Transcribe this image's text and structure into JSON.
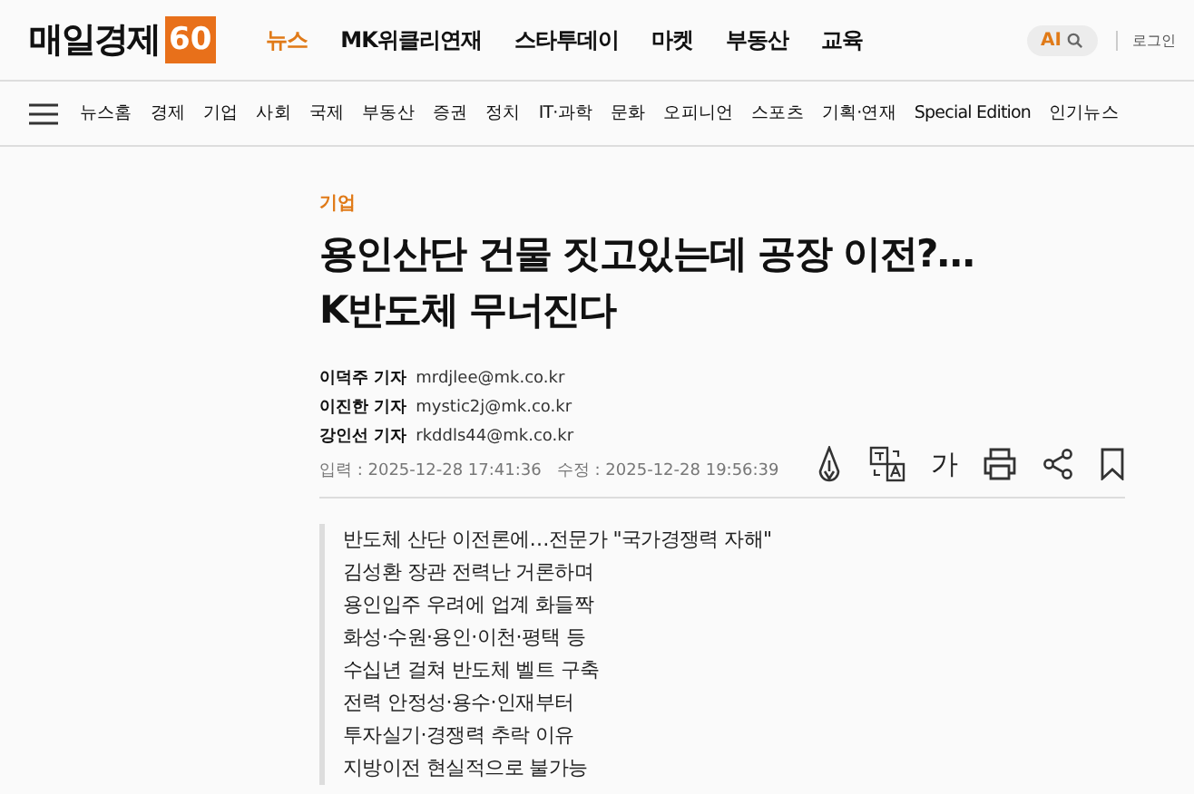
{
  "header": {
    "logo": {
      "text": "매일경제",
      "badge": "60"
    },
    "nav": [
      {
        "label": "뉴스",
        "selected": true
      },
      {
        "label": "MK위클리연재",
        "selected": false
      },
      {
        "label": "스타투데이",
        "selected": false
      },
      {
        "label": "마켓",
        "selected": false
      },
      {
        "label": "부동산",
        "selected": false
      },
      {
        "label": "교육",
        "selected": false
      }
    ],
    "ai_button": "AI",
    "login": "로그인"
  },
  "subnav": [
    "뉴스홈",
    "경제",
    "기업",
    "사회",
    "국제",
    "부동산",
    "증권",
    "정치",
    "IT·과학",
    "문화",
    "오피니언",
    "스포츠",
    "기획·연재",
    "Special Edition",
    "인기뉴스"
  ],
  "article": {
    "category": "기업",
    "title_lines": [
      "용인산단 건물 짓고있는데 공장 이전?…",
      "K반도체 무너진다"
    ],
    "reporters": [
      {
        "name": "이덕주 기자",
        "email": "mrdjlee@mk.co.kr"
      },
      {
        "name": "이진한 기자",
        "email": "mystic2j@mk.co.kr"
      },
      {
        "name": "강인선 기자",
        "email": "rkddls44@mk.co.kr"
      }
    ],
    "dates": "입력 : 2025-12-28 17:41:36   수정 : 2025-12-28 19:56:39",
    "tools": [
      {
        "kind": "ai"
      },
      {
        "kind": "translate"
      },
      {
        "kind": "font",
        "label": "가"
      },
      {
        "kind": "print"
      },
      {
        "kind": "share"
      },
      {
        "kind": "bookmark"
      }
    ],
    "summary": [
      "반도체 산단 이전론에…전문가 \"국가경쟁력 자해\"",
      "김성환 장관 전력난 거론하며",
      "용인입주 우려에 업계 화들짝",
      "화성·수원·용인·이천·평택 등",
      "수십년 걸쳐 반도체 벨트 구축",
      "전력 안정성·용수·인재부터",
      "투자실기·경쟁력 추락 이유",
      "지방이전 현실적으로 불가능"
    ]
  }
}
